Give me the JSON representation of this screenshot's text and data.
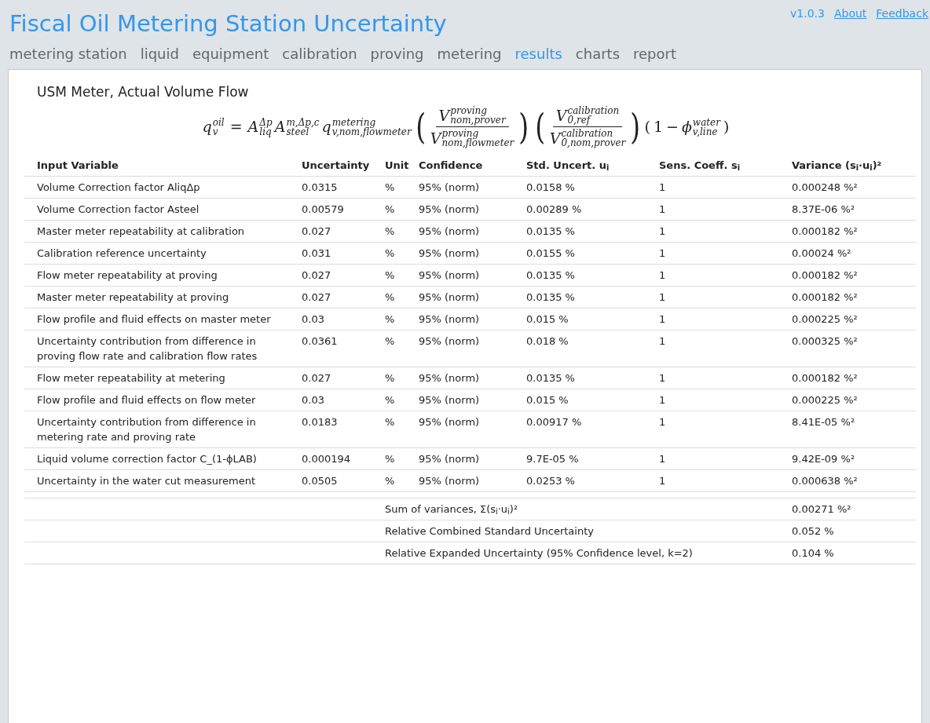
{
  "header": {
    "title": "Fiscal Oil Metering Station Uncertainty",
    "version": "v1.0.3",
    "links": [
      "About",
      "Feedback"
    ]
  },
  "nav": [
    {
      "label": "metering station",
      "selected": false
    },
    {
      "label": "liquid",
      "selected": false
    },
    {
      "label": "equipment",
      "selected": false
    },
    {
      "label": "calibration",
      "selected": false
    },
    {
      "label": "proving",
      "selected": false
    },
    {
      "label": "metering",
      "selected": false
    },
    {
      "label": "results",
      "selected": true
    },
    {
      "label": "charts",
      "selected": false
    },
    {
      "label": "report",
      "selected": false
    }
  ],
  "section": {
    "title": "USM Meter, Actual Volume Flow",
    "formula": {
      "lhs": {
        "base": "q",
        "sup": "oil",
        "sub": "v"
      },
      "equals": "=",
      "factors": [
        {
          "base": "A",
          "sup": "Δp",
          "sub": "liq"
        },
        {
          "base": "A",
          "sup": "m,Δp,c",
          "sub": "steel"
        },
        {
          "base": "q",
          "sup": "metering",
          "sub": "v,nom,flowmeter"
        }
      ],
      "fractions": [
        {
          "open": "(",
          "num": {
            "base": "V",
            "sup": "proving",
            "sub": "nom,prover"
          },
          "den": {
            "base": "V",
            "sup": "proving",
            "sub": "nom,flowmeter"
          },
          "close": ")"
        },
        {
          "open": "(",
          "num": {
            "base": "V",
            "sup": "calibration",
            "sub": "0,ref"
          },
          "den": {
            "base": "V",
            "sup": "calibration",
            "sub": "0,nom,prover"
          },
          "close": ")"
        }
      ],
      "tail": {
        "open": "(",
        "one": "1",
        "minus": "−",
        "term": {
          "base": "ϕ",
          "sup": "water",
          "sub": "v,line"
        },
        "close": ")"
      }
    },
    "table": {
      "columns": [
        "Input Variable",
        "Uncertainty",
        "Unit",
        "Confidence",
        "Std. Uncert. u$_{i}$",
        "Sens. Coeff. s$_{i}$",
        "Variance (s$_{i}$·u$_{i}$)²"
      ],
      "rows": [
        [
          "Volume Correction factor AliqΔp",
          "0.0315",
          "%",
          "95% (norm)",
          "0.0158 %",
          "1",
          "0.000248 %²"
        ],
        [
          "Volume Correction factor Asteel",
          "0.00579",
          "%",
          "95% (norm)",
          "0.00289 %",
          "1",
          "8.37E-06 %²"
        ],
        [
          "Master meter repeatability at calibration",
          "0.027",
          "%",
          "95% (norm)",
          "0.0135 %",
          "1",
          "0.000182 %²"
        ],
        [
          "Calibration reference uncertainty",
          "0.031",
          "%",
          "95% (norm)",
          "0.0155 %",
          "1",
          "0.00024 %²"
        ],
        [
          "Flow meter repeatability at proving",
          "0.027",
          "%",
          "95% (norm)",
          "0.0135 %",
          "1",
          "0.000182 %²"
        ],
        [
          "Master meter repeatability at proving",
          "0.027",
          "%",
          "95% (norm)",
          "0.0135 %",
          "1",
          "0.000182 %²"
        ],
        [
          "Flow profile and fluid effects on master meter",
          "0.03",
          "%",
          "95% (norm)",
          "0.015 %",
          "1",
          "0.000225 %²"
        ],
        [
          "Uncertainty contribution from difference in proving flow rate and calibration flow rates",
          "0.0361",
          "%",
          "95% (norm)",
          "0.018 %",
          "1",
          "0.000325 %²"
        ],
        [
          "Flow meter repeatability at metering",
          "0.027",
          "%",
          "95% (norm)",
          "0.0135 %",
          "1",
          "0.000182 %²"
        ],
        [
          "Flow profile and fluid effects on flow meter",
          "0.03",
          "%",
          "95% (norm)",
          "0.015 %",
          "1",
          "0.000225 %²"
        ],
        [
          "Uncertainty contribution from difference in metering rate and proving rate",
          "0.0183",
          "%",
          "95% (norm)",
          "0.00917 %",
          "1",
          "8.41E-05 %²"
        ],
        [
          "Liquid volume correction factor C_(1-ϕLAB)",
          "0.000194",
          "%",
          "95% (norm)",
          "9.7E-05 %",
          "1",
          "9.42E-09 %²"
        ],
        [
          "Uncertainty in the water cut measurement",
          "0.0505",
          "%",
          "95% (norm)",
          "0.0253 %",
          "1",
          "0.000638 %²"
        ]
      ],
      "summary": [
        {
          "label": "Sum of variances, Σ(s$_{i}$·u$_{i}$)²",
          "value": "0.00271 %²"
        },
        {
          "label": "Relative Combined Standard Uncertainty",
          "value": "0.052 %"
        },
        {
          "label": "Relative Expanded Uncertainty (95% Confidence level, k=2)",
          "value": "0.104 %"
        }
      ]
    }
  }
}
